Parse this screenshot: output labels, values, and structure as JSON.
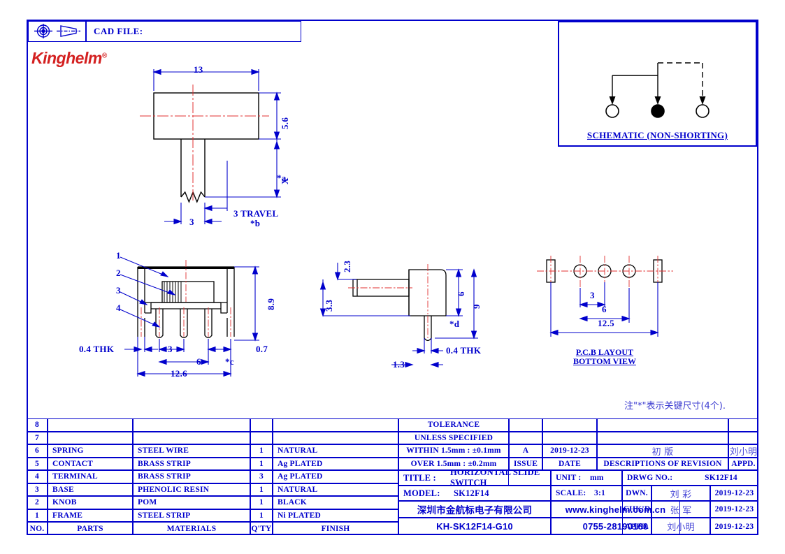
{
  "header": {
    "projection_symbol": "first-angle-projection-symbol",
    "cad_file_label": "CAD  FILE:",
    "brand": "Kinghelm",
    "brand_mark": "®",
    "brand_color": "#d42020",
    "line_color": "#0000cc",
    "centerline_color": "#e03030"
  },
  "schematic": {
    "caption": "SCHEMATIC  (NON-SHORTING)",
    "terminals": [
      {
        "id": "terminal-1",
        "filled": false
      },
      {
        "id": "terminal-2",
        "filled": true
      },
      {
        "id": "terminal-3",
        "filled": false
      }
    ]
  },
  "views": {
    "top": {
      "dims": {
        "width": "13",
        "height": "5.6",
        "travel_height": "X",
        "travel_key": "*a",
        "knob_width": "3",
        "travel": "3  TRAVEL",
        "travel_key2": "*b"
      }
    },
    "front": {
      "callouts": [
        "1",
        "2",
        "3",
        "4"
      ],
      "dims": {
        "height": "8.9",
        "thickness": "0.4  THK",
        "pitch": "3",
        "span": "6",
        "key_c": "*c",
        "pin_width": "0.7",
        "overall": "12.6"
      }
    },
    "side": {
      "dims": {
        "knob_top": "2.3",
        "knob_bottom": "3.3",
        "body_height": "6",
        "overall_height": "9",
        "key_d": "*d",
        "thickness": "0.4  THK",
        "pin_offset": "1.3"
      }
    },
    "pcb": {
      "caption_line1": "P.C.B  LAYOUT",
      "caption_line2": "BOTTOM  VIEW",
      "dims": {
        "pitch": "3",
        "span": "6",
        "overall": "12.5"
      }
    }
  },
  "note": "注\"*\"表示关键尺寸(4个).",
  "parts_table": {
    "headers": [
      "NO.",
      "PARTS",
      "MATERIALS",
      "Q'TY",
      "FINISH"
    ],
    "rows": [
      {
        "no": "8",
        "part": "",
        "material": "",
        "qty": "",
        "finish": ""
      },
      {
        "no": "7",
        "part": "",
        "material": "",
        "qty": "",
        "finish": ""
      },
      {
        "no": "6",
        "part": "SPRING",
        "material": "STEEL  WIRE",
        "qty": "1",
        "finish": "NATURAL"
      },
      {
        "no": "5",
        "part": "CONTACT",
        "material": "BRASS  STRIP",
        "qty": "1",
        "finish": "Ag  PLATED"
      },
      {
        "no": "4",
        "part": "TERMINAL",
        "material": "BRASS  STRIP",
        "qty": "3",
        "finish": "Ag  PLATED"
      },
      {
        "no": "3",
        "part": "BASE",
        "material": "PHENOLIC  RESIN",
        "qty": "1",
        "finish": "NATURAL"
      },
      {
        "no": "2",
        "part": "KNOB",
        "material": "POM",
        "qty": "1",
        "finish": "BLACK"
      },
      {
        "no": "1",
        "part": "FRAME",
        "material": "STEEL  STRIP",
        "qty": "1",
        "finish": "Ni  PLATED"
      }
    ]
  },
  "tolerance": {
    "line1": "TOLERANCE",
    "line2": "UNLESS   SPECIFIED",
    "within": "WITHIN 1.5mm : ±0.1mm",
    "over": "OVER 1.5mm : ±0.2mm"
  },
  "revision": {
    "issue_value": "A",
    "date_value": "2019-12-23",
    "description_value": "初    版",
    "appd_value": "刘小明",
    "issue_label": "ISSUE",
    "date_label": "DATE",
    "description_label": "DESCRIPTIONS  OF  REVISION",
    "appd_label": "APPD."
  },
  "title_block": {
    "title_label": "TITLE :",
    "title_value": "HORIZONTAL  SLIDE  SWITCH",
    "model_label": "MODEL:",
    "model_value": "SK12F14",
    "unit_label": "UNIT :",
    "unit_value": "mm",
    "scale_label": "SCALE:",
    "scale_value": "3:1",
    "drwg_label": "DRWG NO.:",
    "drwg_value": "SK12F14",
    "dwn_label": "DWN.",
    "dwn_value": "刘 彩",
    "dwn_date": "2019-12-23",
    "chkd_label": "CHK'D",
    "chkd_value": "张 军",
    "chkd_date": "2019-12-23",
    "appd_label": "APPD.",
    "appd_value": "刘小明",
    "appd_date": "2019-12-23",
    "company": "深圳市金航标电子有限公司",
    "website": "www.kinghelm.com.cn",
    "part_number": "KH-SK12F14-G10",
    "phone": "0755-28190160"
  }
}
